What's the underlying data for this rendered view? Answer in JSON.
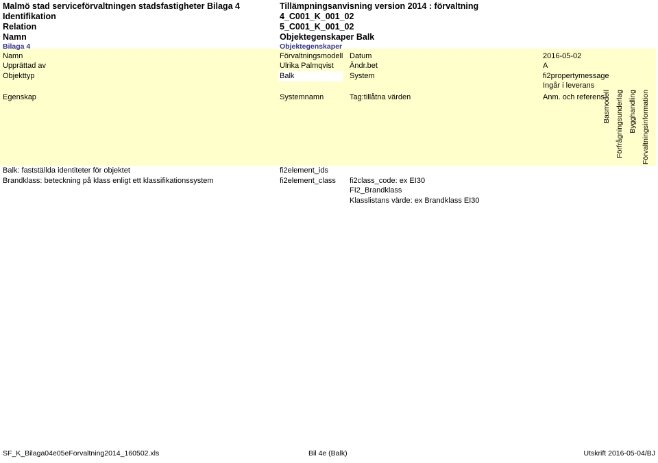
{
  "document": {
    "title_rows": [
      {
        "left": "Malmö stad serviceförvaltningen stadsfastigheter Bilaga 4",
        "right": "Tillämpningsanvisning version 2014 : förvaltning"
      },
      {
        "left": "Identifikation",
        "right": "4_C001_K_001_02"
      },
      {
        "left": "Relation",
        "right": "5_C001_K_001_02"
      },
      {
        "left": "Namn",
        "right": "Objektegenskaper Balk"
      }
    ],
    "subtitle_row": {
      "left": "Bilaga 4",
      "right": "Objektegenskaper"
    }
  },
  "meta": {
    "rows": [
      {
        "label": "Namn",
        "value": "Förvaltningsmodell",
        "label2": "Datum",
        "value2": "2016-05-02"
      },
      {
        "label": "Upprättad av",
        "value": "Ulrika Palmqvist",
        "label2": "Ändr.bet",
        "value2": "A"
      },
      {
        "label": "Objekttyp",
        "value": "Balk",
        "label2": "System",
        "value2": "fi2propertymessage"
      }
    ],
    "delivery_note": "Ingår i leverans"
  },
  "table": {
    "headers": {
      "col_a": "Egenskap",
      "col_b": "Systemnamn",
      "col_c": "Tag:tillåtna värden",
      "col_d": "Anm. och referens"
    },
    "vertical_headers": [
      "Basmodell",
      "Förfrågningsunderlag",
      "Bygghandling",
      "Förvaltningsinformation"
    ],
    "rows": [
      {
        "egenskap": "Balk: fastställda identiteter för objektet",
        "systemnamn": "fi2element_ids",
        "tag": "",
        "anm": ""
      },
      {
        "egenskap": "Brandklass: beteckning på klass enligt ett klassifikationssystem",
        "systemnamn": "fi2element_class",
        "tag": "fi2class_code: ex EI30",
        "anm": ""
      }
    ],
    "tag_extra_lines": [
      "FI2_Brandklass",
      "Klasslistans värde: ex Brandklass EI30"
    ]
  },
  "footer": {
    "left": "SF_K_Bilaga04e05eForvaltning2014_160502.xls",
    "middle": "Bil 4e (Balk)",
    "right": "Utskrift 2016-05-04/BJ"
  },
  "colors": {
    "fill": "#FFFFCC",
    "accent_blue": "#333399",
    "text": "#000000",
    "page": "#FFFFFF"
  }
}
